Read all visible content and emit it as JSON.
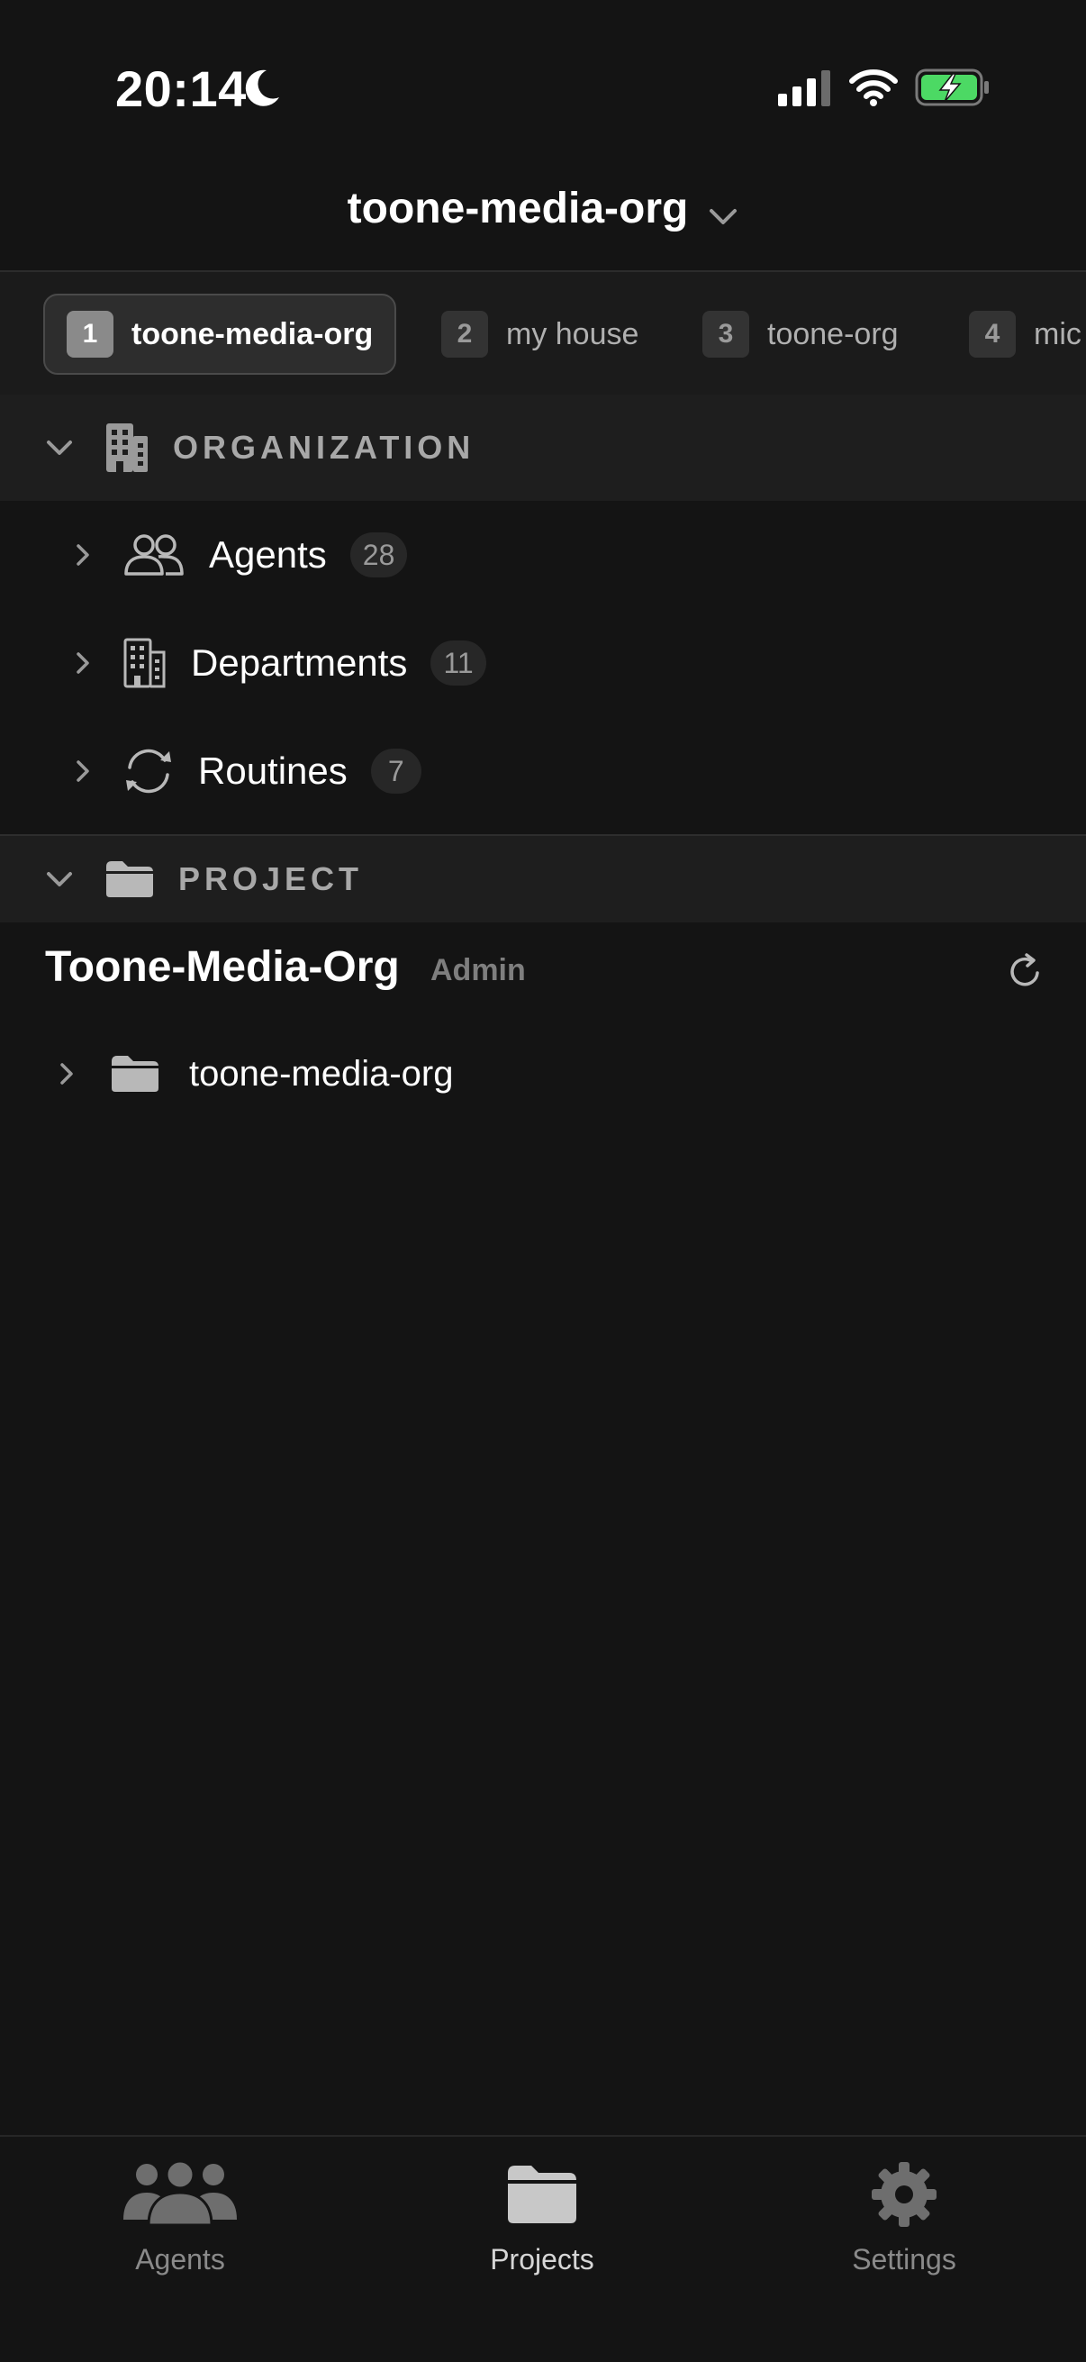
{
  "status_bar": {
    "time": "20:14"
  },
  "header": {
    "title": "toone-media-org"
  },
  "org_tabs": [
    {
      "num": "1",
      "label": "toone-media-org",
      "active": true
    },
    {
      "num": "2",
      "label": "my house",
      "active": false
    },
    {
      "num": "3",
      "label": "toone-org",
      "active": false
    },
    {
      "num": "4",
      "label": "mic",
      "active": false
    }
  ],
  "organization": {
    "title": "ORGANIZATION",
    "items": [
      {
        "label": "Agents",
        "count": "28",
        "icon": "people-icon"
      },
      {
        "label": "Departments",
        "count": "11",
        "icon": "building-icon"
      },
      {
        "label": "Routines",
        "count": "7",
        "icon": "cycle-icon"
      }
    ]
  },
  "project": {
    "title": "PROJECT",
    "name": "Toone-Media-Org",
    "role": "Admin",
    "folders": [
      {
        "label": "toone-media-org",
        "icon": "folder-icon"
      }
    ]
  },
  "bottom_nav": [
    {
      "label": "Agents",
      "icon": "people-icon",
      "active": false
    },
    {
      "label": "Projects",
      "icon": "folder-icon",
      "active": true
    },
    {
      "label": "Settings",
      "icon": "gear-icon",
      "active": false
    }
  ],
  "colors": {
    "background": "#141414",
    "battery_green": "#4cd964",
    "muted": "#8a8a8a"
  }
}
